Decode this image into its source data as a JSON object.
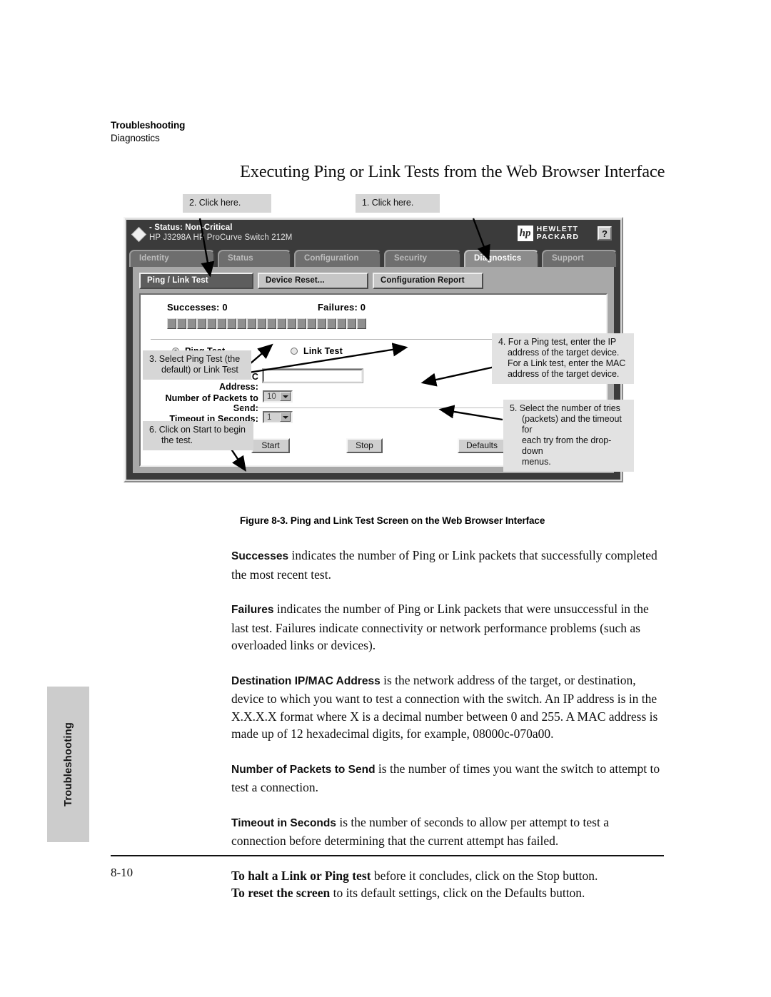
{
  "header": {
    "chapter": "Troubleshooting",
    "section": "Diagnostics"
  },
  "heading": "Executing Ping or Link Tests from the Web Browser Interface",
  "figure": {
    "caption": "Figure 8-3.   Ping and Link Test Screen on the Web Browser Interface",
    "callouts": [
      {
        "id": "callout-1",
        "text": "1. Click here."
      },
      {
        "id": "callout-2",
        "text": "2. Click here."
      },
      {
        "id": "callout-3",
        "line1": "3. Select Ping Test (the",
        "line2": "default) or Link Test"
      },
      {
        "id": "callout-4",
        "text": "4. For a Ping test, enter the IP address of the target device. For a Link test, enter the MAC address of the target device."
      },
      {
        "id": "callout-5",
        "line1": "5. Select the number of tries",
        "line2": "(packets) and the timeout for",
        "line3": "each try from the drop-down",
        "line4": "menus."
      },
      {
        "id": "callout-6",
        "line1": "6. Click on Start to begin",
        "line2": "the test."
      }
    ],
    "window": {
      "status_label": "- Status:  Non-Critical",
      "model": "HP J3298A HP ProCurve Switch 212M",
      "brand_line1": "HEWLETT",
      "brand_line2": "PACKARD",
      "brand_mark": "hp",
      "help_label": "?",
      "tabs": [
        {
          "label": "Identity",
          "active": false
        },
        {
          "label": "Status",
          "active": false
        },
        {
          "label": "Configuration",
          "active": false
        },
        {
          "label": "Security",
          "active": false
        },
        {
          "label": "Diagnostics",
          "active": true
        },
        {
          "label": "Support",
          "active": false
        }
      ],
      "subtabs": [
        {
          "label": "Ping / Link Test",
          "active": true
        },
        {
          "label": "Device Reset...",
          "active": false
        },
        {
          "label": "Configuration Report",
          "active": false
        }
      ],
      "counters": {
        "successes_label": "Successes: 0",
        "failures_label": "Failures: 0",
        "segment_count": 20
      },
      "form": {
        "ping_test_label": "Ping Test",
        "link_test_label": "Link Test",
        "ping_selected": true,
        "link_selected": false,
        "destination_label": "Destination IP/MAC Address:",
        "destination_value": "",
        "packets_label": "Number of Packets to Send:",
        "packets_value": "10",
        "timeout_label": "Timeout in Seconds:",
        "timeout_value": "1"
      },
      "buttons": {
        "start": "Start",
        "stop": "Stop",
        "defaults": "Defaults"
      }
    }
  },
  "body": {
    "p1_term": "Successes",
    "p1_text": " indicates the number of Ping or Link packets that successfully completed the most recent test.",
    "p2_term": "Failures",
    "p2_text": " indicates the number of Ping or Link packets that were unsuccessful in the last test. Failures indicate connectivity or network performance problems (such as overloaded links or devices).",
    "p3_term": "Destination IP/MAC Address",
    "p3_text": " is the network address of the target, or destination, device to which you want to test a connection with the switch. An IP address is in the X.X.X.X format where X is a decimal number between 0 and 255. A MAC address is made up of 12 hexadecimal digits, for example, 08000c-070a00.",
    "p4_term": "Number of Packets to Send",
    "p4_text": " is the number of times you want the switch to attempt to test a connection.",
    "p5_term": "Timeout in Seconds",
    "p5_text": " is the number of seconds to allow per attempt to test a connection before determining that the current attempt has failed.",
    "p6_term": "To halt a Link or Ping test",
    "p6_text": " before it concludes, click on the Stop button.",
    "p7_term": "To reset the screen",
    "p7_text": " to its default settings, click on the Defaults button."
  },
  "thumb_tab": "Troubleshooting",
  "page_number": "8-10"
}
